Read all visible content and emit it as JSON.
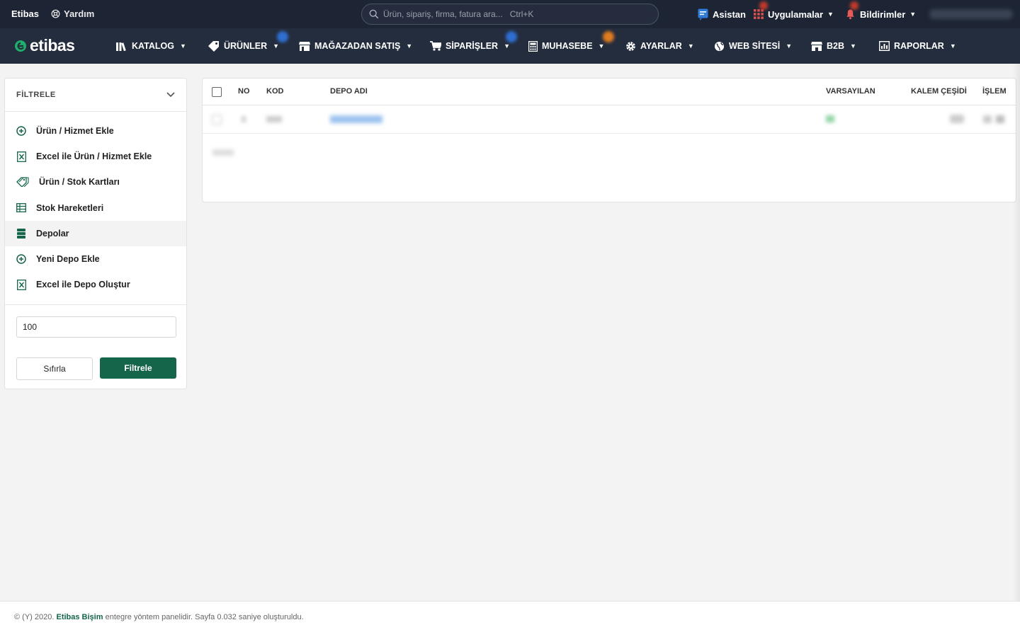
{
  "topbar": {
    "brand": "Etibas",
    "help_label": "Yardım",
    "search_placeholder": "Ürün, sipariş, firma, fatura ara...   Ctrl+K",
    "assistant_label": "Asistan",
    "apps_label": "Uygulamalar",
    "notifications_label": "Bildirimler"
  },
  "nav": {
    "logo_text": "etibas",
    "items": [
      {
        "label": "KATALOG",
        "icon": "library-icon"
      },
      {
        "label": "ÜRÜNLER",
        "icon": "tag-icon"
      },
      {
        "label": "MAĞAZADAN SATIŞ",
        "icon": "store-icon"
      },
      {
        "label": "SİPARİŞLER",
        "icon": "cart-icon"
      },
      {
        "label": "MUHASEBE",
        "icon": "calculator-icon"
      },
      {
        "label": "AYARLAR",
        "icon": "gear-icon"
      },
      {
        "label": "WEB SİTESİ",
        "icon": "globe-icon"
      },
      {
        "label": "B2B",
        "icon": "shop-icon"
      },
      {
        "label": "RAPORLAR",
        "icon": "report-icon"
      }
    ]
  },
  "sidebar": {
    "title": "FİLTRELE",
    "items": [
      {
        "label": "Ürün / Hizmet Ekle",
        "icon": "plus-circle-icon"
      },
      {
        "label": "Excel ile Ürün / Hizmet Ekle",
        "icon": "excel-icon"
      },
      {
        "label": "Ürün / Stok Kartları",
        "icon": "tags-icon"
      },
      {
        "label": "Stok Hareketleri",
        "icon": "table-icon"
      },
      {
        "label": "Depolar",
        "icon": "database-icon"
      },
      {
        "label": "Yeni Depo Ekle",
        "icon": "plus-circle-icon"
      },
      {
        "label": "Excel ile Depo Oluştur",
        "icon": "excel-icon"
      }
    ],
    "active_index": 4,
    "limit_value": "100",
    "reset_label": "Sıfırla",
    "filter_label": "Filtrele"
  },
  "table": {
    "columns": [
      "NO",
      "KOD",
      "DEPO ADI",
      "VARSAYILAN",
      "KALEM ÇEŞİDİ",
      "İŞLEM"
    ]
  },
  "footer": {
    "prefix": "© (Y) 2020.",
    "company": "Etibas Bişim",
    "suffix": "entegre yöntem panelidir. Sayfa 0.032 saniye oluşturuldu."
  },
  "colors": {
    "topbar_bg": "#1d2535",
    "nav_bg": "#242d3e",
    "accent_green": "#15654b",
    "page_bg": "#f3f3f3"
  }
}
